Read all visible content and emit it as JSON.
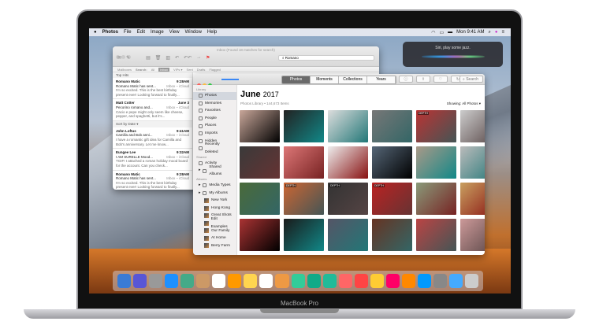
{
  "device": {
    "label": "MacBook Pro"
  },
  "menubar": {
    "app": "Photos",
    "items": [
      "File",
      "Edit",
      "Image",
      "View",
      "Window",
      "Help"
    ],
    "clock": "Mon 9:41 AM"
  },
  "siri": {
    "prompt": "Siri, play some jazz."
  },
  "mail": {
    "title": "Inbox (Found 18 matches for search)",
    "search_value": "Romano",
    "scope": {
      "mailboxes": "Mailboxes",
      "search_label": "Search:",
      "items": [
        "All",
        "Inbox",
        "VIPs ▾",
        "Sent",
        "Drafts",
        "Flagged"
      ]
    },
    "top_hits_label": "Top Hits",
    "sort_label": "Sort by Date ▾",
    "top_hits": [
      {
        "from": "Romano Matic",
        "time": "9:28AM",
        "subject": "Romano Matic has sent...",
        "box": "Inbox – iCloud",
        "preview": "I'm so excited. This is the best birthday present ever! Looking forward to finally..."
      },
      {
        "from": "Matt Cotter",
        "time": "June 3",
        "subject": "Pecorino romano and...",
        "box": "Inbox – iCloud",
        "preview": "Cacio e pepe might only seem like cheese, pepper, and spaghetti, but it's..."
      }
    ],
    "messages": [
      {
        "from": "John Loftus",
        "time": "9:41AM",
        "subject": "Camilla and Bob anni...",
        "box": "Inbox – iCloud",
        "preview": "I have a romantic gift idea for Camilla and Bob's anniversary. Let me know..."
      },
      {
        "from": "Eungee Lee",
        "time": "9:32AM",
        "subject": "I AM SURELLE Mood...",
        "box": "Inbox – iCloud",
        "preview": "TGIF! I attached a roman holiday mood board for the account. Can you check..."
      },
      {
        "from": "Romano Matic",
        "time": "9:28AM",
        "subject": "Romano Matic has sent...",
        "box": "Inbox – iCloud",
        "preview": "I'm so excited. This is the best birthday present ever! Looking forward to finally..."
      }
    ]
  },
  "photos": {
    "tabs": [
      "Photos",
      "Moments",
      "Collections",
      "Years"
    ],
    "active_tab": "Photos",
    "search_placeholder": "Search",
    "heading_month": "June",
    "heading_year": "2017",
    "subtitle": "Photos Library • 144,673 Items",
    "showing": "Showing: All Photos ▾",
    "sidebar": {
      "library_label": "Library",
      "library": [
        "Photos",
        "Memories",
        "Favorites",
        "People",
        "Places",
        "Imports",
        "Hidden",
        "Recently Deleted"
      ],
      "shared_label": "Shared",
      "shared": [
        "Activity",
        "Shared Albums"
      ],
      "albums_label": "Albums",
      "albums": [
        "Media Types",
        "My Albums"
      ],
      "my_albums": [
        "New York",
        "Hong Kong",
        "Great Shots",
        "Edit Examples",
        "Our Family",
        "At Home",
        "Berry Farm"
      ]
    },
    "depth_tag": "DEPTH",
    "thumb_colors": [
      "#c9a79a",
      "#222",
      "#ddd",
      "#777",
      "#b33",
      "#ccc",
      "#3a3a3a",
      "#d77",
      "#eee",
      "#567",
      "#a98",
      "#bbb",
      "#4a6a3a",
      "#c63",
      "#333",
      "#b22",
      "#8a9a7a",
      "#c9a060",
      "#a33",
      "#1a1a1a",
      "#556",
      "#632",
      "#b44",
      "#c99",
      "#888",
      "#9ab",
      "#a86",
      "#ccc",
      "#edd",
      "#777"
    ]
  },
  "dock": {
    "colors": [
      "#3a7bd5",
      "#5856d6",
      "#999",
      "#1e90ff",
      "#4a8",
      "#c96",
      "#fff",
      "#f90",
      "#ffd54f",
      "#fff",
      "#e94",
      "#3c9",
      "#1a8",
      "#2b9",
      "#f66",
      "#f44",
      "#fc3",
      "#f06",
      "#f80",
      "#09f",
      "#888",
      "#4af",
      "#ccc"
    ]
  }
}
